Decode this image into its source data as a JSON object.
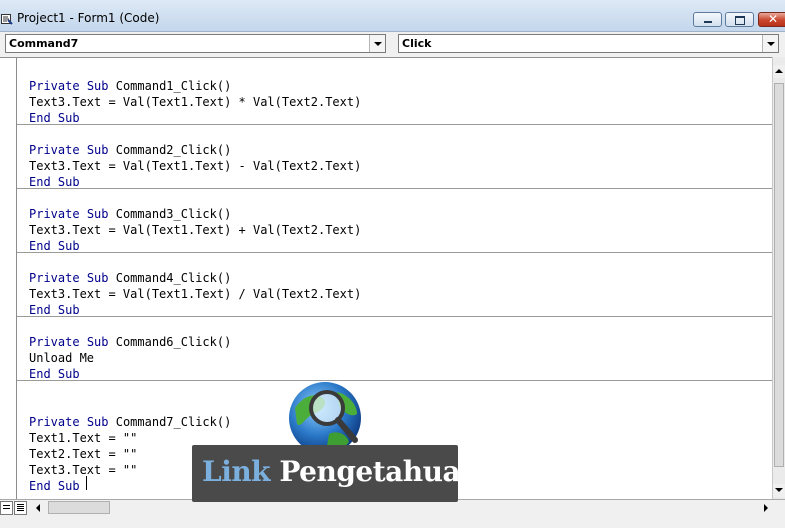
{
  "window": {
    "title": "Project1 - Form1 (Code)",
    "close_glyph": "✕"
  },
  "dropdowns": {
    "object": "Command7",
    "procedure": "Click"
  },
  "procedures": [
    {
      "lines": [
        {
          "kw1": "Private",
          "kw2": "Sub",
          "rest": " Command1_Click()"
        },
        {
          "text": "Text3.Text = Val(Text1.Text) * Val(Text2.Text)"
        },
        {
          "kw1": "End",
          "kw2": "Sub"
        }
      ]
    },
    {
      "lines": [
        {
          "kw1": "Private",
          "kw2": "Sub",
          "rest": " Command2_Click()"
        },
        {
          "text": "Text3.Text = Val(Text1.Text) - Val(Text2.Text)"
        },
        {
          "kw1": "End",
          "kw2": "Sub"
        }
      ]
    },
    {
      "lines": [
        {
          "kw1": "Private",
          "kw2": "Sub",
          "rest": " Command3_Click()"
        },
        {
          "text": "Text3.Text = Val(Text1.Text) + Val(Text2.Text)"
        },
        {
          "kw1": "End",
          "kw2": "Sub"
        }
      ]
    },
    {
      "lines": [
        {
          "kw1": "Private",
          "kw2": "Sub",
          "rest": " Command4_Click()"
        },
        {
          "text": "Text3.Text = Val(Text1.Text) / Val(Text2.Text)"
        },
        {
          "kw1": "End",
          "kw2": "Sub"
        }
      ]
    },
    {
      "lines": [
        {
          "kw1": "Private",
          "kw2": "Sub",
          "rest": " Command6_Click()"
        },
        {
          "text": "Unload Me"
        },
        {
          "kw1": "End",
          "kw2": "Sub"
        }
      ]
    },
    {
      "lines": [
        {
          "kw1": "Private",
          "kw2": "Sub",
          "rest": " Command7_Click()"
        },
        {
          "text": "Text1.Text = \"\""
        },
        {
          "text": "Text2.Text = \"\""
        },
        {
          "text": "Text3.Text = \"\""
        },
        {
          "kw1": "End",
          "kw2": "Sub"
        }
      ]
    }
  ],
  "watermark": {
    "word1": "Link",
    "word2": "Pengetahuan"
  },
  "colors": {
    "keyword": "#00008b",
    "code_text": "#000000",
    "logo_bg": "#4a4a4a",
    "logo_accent": "#7bb0de"
  }
}
